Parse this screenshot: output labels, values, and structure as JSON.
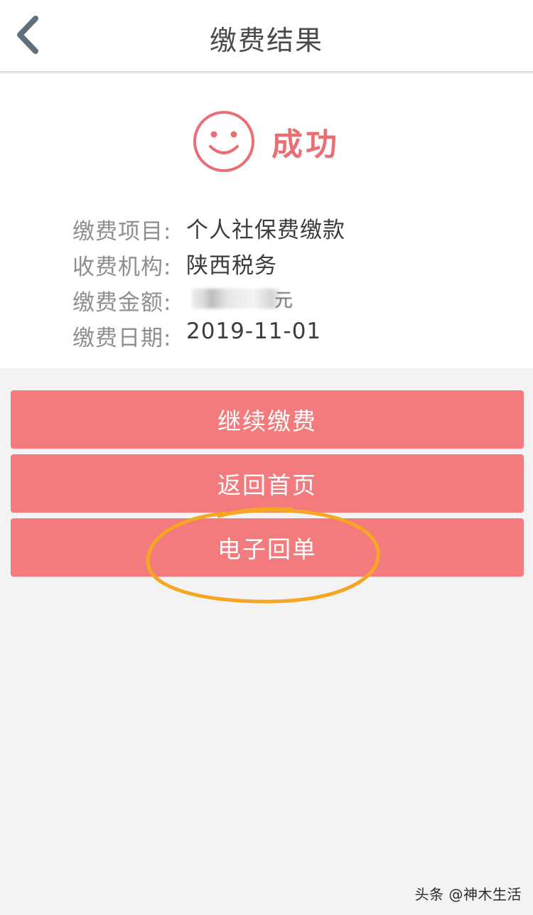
{
  "header": {
    "title": "缴费结果",
    "back_icon": "chevron-left-icon"
  },
  "result": {
    "icon": "smile-face-icon",
    "status_text": "成功",
    "accent_color": "#e96f75"
  },
  "info": {
    "rows": [
      {
        "label": "缴费项目:",
        "value": "个人社保费缴款"
      },
      {
        "label": "收费机构:",
        "value": "陕西税务"
      },
      {
        "label": "缴费金额:",
        "value": "元"
      },
      {
        "label": "缴费日期:",
        "value": "2019-11-01"
      }
    ]
  },
  "buttons": {
    "continue_label": "继续缴费",
    "home_label": "返回首页",
    "receipt_label": "电子回单",
    "color": "#f37a7d"
  },
  "annotation": {
    "color": "#f5a623"
  },
  "watermark": {
    "text": "头条 @神木生活"
  }
}
